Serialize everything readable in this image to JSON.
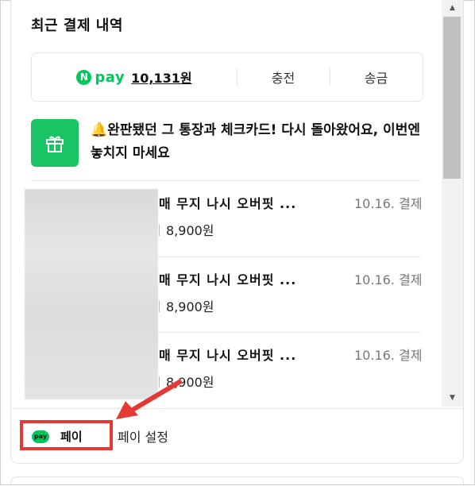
{
  "header": {
    "title": "최근 결제 내역"
  },
  "pay_card": {
    "badge": "N",
    "brand": "pay",
    "balance": "10,131원",
    "charge_label": "충전",
    "send_label": "송금"
  },
  "promo": {
    "icon": "gift-icon",
    "bell": "🔔",
    "text": "완판됐던 그 통장과 체크카드! 다시 돌아왔어요, 이번엔 놓치지 마세요"
  },
  "payments": [
    {
      "name": "매 무지 나시 오버핏 ...",
      "date": "10.16. 결제",
      "price": "8,900원"
    },
    {
      "name": "매 무지 나시 오버핏 ...",
      "date": "10.16. 결제",
      "price": "8,900원"
    },
    {
      "name": "매 무지 나시 오버핏 ...",
      "date": "10.16. 결제",
      "price": "8,900원"
    }
  ],
  "footer": {
    "chip_icon": "pay",
    "chip_label": "페이",
    "settings_label": "페이 설정"
  },
  "colors": {
    "brand_green": "#03c75a",
    "highlight_red": "#e53935"
  }
}
